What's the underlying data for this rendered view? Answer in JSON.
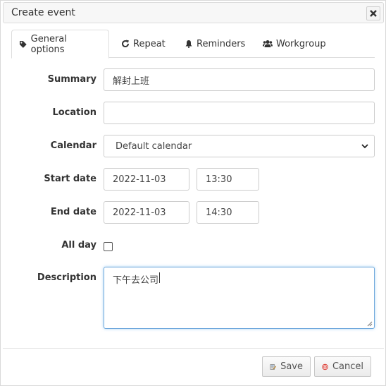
{
  "dialog": {
    "title": "Create event"
  },
  "tabs": [
    {
      "label": "General options",
      "icon": "tag-icon",
      "active": true
    },
    {
      "label": "Repeat",
      "icon": "refresh-icon"
    },
    {
      "label": "Reminders",
      "icon": "bell-icon"
    },
    {
      "label": "Workgroup",
      "icon": "users-icon"
    }
  ],
  "form": {
    "summary": {
      "label": "Summary",
      "value": "解封上班"
    },
    "location": {
      "label": "Location",
      "value": ""
    },
    "calendar": {
      "label": "Calendar",
      "value": "Default calendar"
    },
    "start": {
      "label": "Start date",
      "date": "2022-11-03",
      "time": "13:30"
    },
    "end": {
      "label": "End date",
      "date": "2022-11-03",
      "time": "14:30"
    },
    "allday": {
      "label": "All day",
      "checked": false
    },
    "description": {
      "label": "Description",
      "value": "下午去公司"
    }
  },
  "footer": {
    "save_label": "Save",
    "cancel_label": "Cancel"
  },
  "colors": {
    "focus_border": "#6fa8dc",
    "cancel_icon": "#d9342b"
  }
}
